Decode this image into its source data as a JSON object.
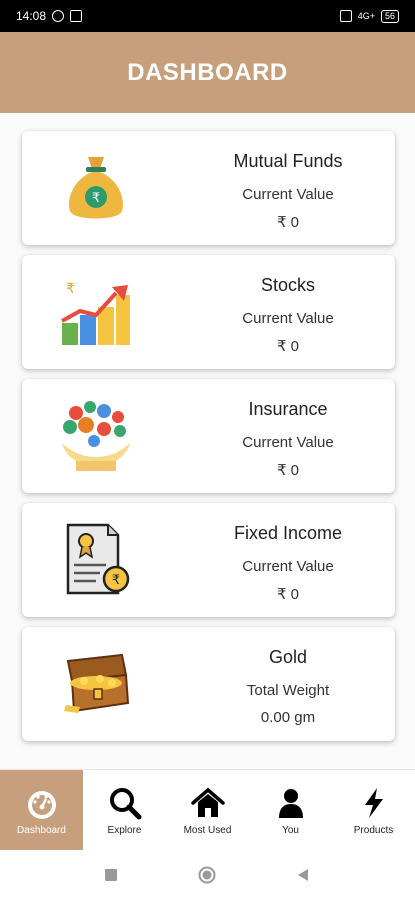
{
  "status_bar": {
    "time": "14:08",
    "network": "4G+",
    "battery": "56"
  },
  "app_bar": {
    "title": "DASHBOARD"
  },
  "cards": [
    {
      "title": "Mutual Funds",
      "subtitle": "Current Value",
      "value": "₹ 0",
      "icon": "money-bag-icon"
    },
    {
      "title": "Stocks",
      "subtitle": "Current Value",
      "value": "₹ 0",
      "icon": "growth-chart-icon"
    },
    {
      "title": "Insurance",
      "subtitle": "Current Value",
      "value": "₹ 0",
      "icon": "insurance-hands-icon"
    },
    {
      "title": "Fixed Income",
      "subtitle": "Current Value",
      "value": "₹ 0",
      "icon": "certificate-icon"
    },
    {
      "title": "Gold",
      "subtitle": "Total Weight",
      "value": "0.00 gm",
      "icon": "treasure-chest-icon"
    }
  ],
  "bottom_nav": [
    {
      "label": "Dashboard",
      "icon": "speedometer-icon",
      "active": true
    },
    {
      "label": "Explore",
      "icon": "search-icon",
      "active": false
    },
    {
      "label": "Most Used",
      "icon": "home-icon",
      "active": false
    },
    {
      "label": "You",
      "icon": "user-icon",
      "active": false
    },
    {
      "label": "Products",
      "icon": "lightning-icon",
      "active": false
    }
  ],
  "colors": {
    "accent": "#c6a07c",
    "status_bar": "#000000",
    "text": "#222222"
  }
}
